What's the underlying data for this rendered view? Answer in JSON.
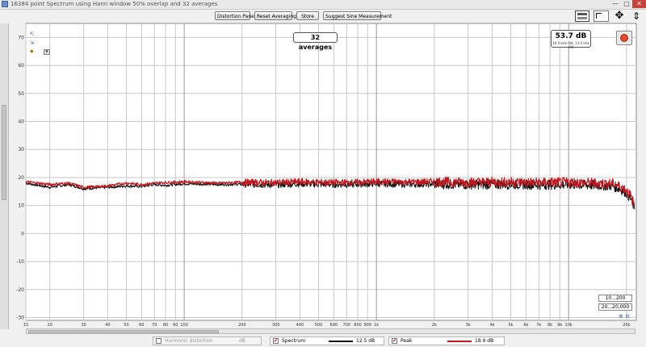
{
  "window": {
    "title": "16384 point Spectrum using Hann window 50% overlap and 32 averages",
    "controls": [
      "—",
      "□",
      "✕"
    ]
  },
  "toolbar": {
    "distortion_label": "Distortion Panel",
    "reset_label": "Reset Averaging",
    "store_label": "Store",
    "suggest_label": "Suggest Sine Measurement"
  },
  "overlay": {
    "averages": "32 averages",
    "level_value": "53.7 dB",
    "level_sub": "16.0 kHz BW, 12.0 kHz BW",
    "range_y": "10...200",
    "range_x": "20...20,000"
  },
  "legend": {
    "thd_label": "Harmonic distortion",
    "thd_value": "dB",
    "spectrum_label": "Spectrum",
    "spectrum_value": "12.5 dB",
    "peak_label": "Peak",
    "peak_value": "18.9 dB",
    "spectrum_color": "#111111",
    "peak_color": "#c8161c"
  },
  "chart_data": {
    "type": "line",
    "title": "",
    "xlabel": "",
    "ylabel": "",
    "x_scale": "log",
    "xlim": [
      15,
      22500
    ],
    "ylim": [
      -31,
      75
    ],
    "grid": true,
    "y_ticks": [
      70,
      60,
      50,
      40,
      30,
      20,
      10,
      0,
      -10,
      -20,
      -30
    ],
    "y_tick_labels": [
      "70",
      "60",
      "50",
      "40",
      "30",
      "20",
      "10",
      "0",
      "-10",
      "-20",
      "-30"
    ],
    "x_ticks": [
      15,
      20,
      30,
      40,
      50,
      60,
      70,
      80,
      90,
      100,
      200,
      300,
      400,
      500,
      600,
      700,
      800,
      900,
      1000,
      2000,
      3000,
      4000,
      5000,
      6000,
      7000,
      8000,
      9000,
      10000,
      20000
    ],
    "x_tick_labels": [
      "15",
      "20",
      "30",
      "40",
      "50",
      "60",
      "70",
      "80",
      "90",
      "100",
      "200",
      "300",
      "400",
      "500",
      "600",
      "700",
      "800",
      "900",
      "1k",
      "2k",
      "3k",
      "4k",
      "5k",
      "6k",
      "7k",
      "8k",
      "9k",
      "10k",
      "20k"
    ],
    "series": [
      {
        "name": "Spectrum",
        "color": "#111111",
        "x": [
          15,
          20,
          25,
          30,
          40,
          50,
          60,
          70,
          80,
          100,
          150,
          200,
          300,
          400,
          500,
          700,
          1000,
          1500,
          2000,
          3000,
          5000,
          7000,
          10000,
          14000,
          17000,
          19000,
          20000,
          21000,
          22000
        ],
        "y": [
          18.0,
          16.5,
          17.5,
          16.0,
          16.5,
          17.0,
          16.8,
          17.5,
          17.2,
          17.8,
          17.5,
          17.6,
          17.4,
          17.8,
          17.6,
          17.5,
          17.8,
          17.6,
          17.7,
          17.5,
          17.6,
          17.4,
          17.5,
          17.2,
          17.0,
          15.5,
          14.5,
          12.5,
          9.0
        ]
      },
      {
        "name": "Peak",
        "color": "#c8161c",
        "x": [
          15,
          20,
          25,
          30,
          40,
          50,
          60,
          70,
          80,
          100,
          150,
          200,
          300,
          400,
          500,
          700,
          1000,
          1500,
          2000,
          3000,
          5000,
          7000,
          10000,
          14000,
          17000,
          19000,
          20000,
          21000,
          22000
        ],
        "y": [
          18.5,
          17.5,
          18.0,
          16.5,
          17.0,
          18.0,
          17.5,
          18.0,
          18.2,
          18.5,
          18.0,
          18.3,
          18.2,
          18.5,
          18.3,
          18.2,
          18.5,
          18.4,
          18.5,
          18.3,
          18.4,
          18.2,
          18.3,
          18.0,
          17.8,
          16.5,
          15.5,
          13.5,
          10.0
        ]
      }
    ]
  }
}
